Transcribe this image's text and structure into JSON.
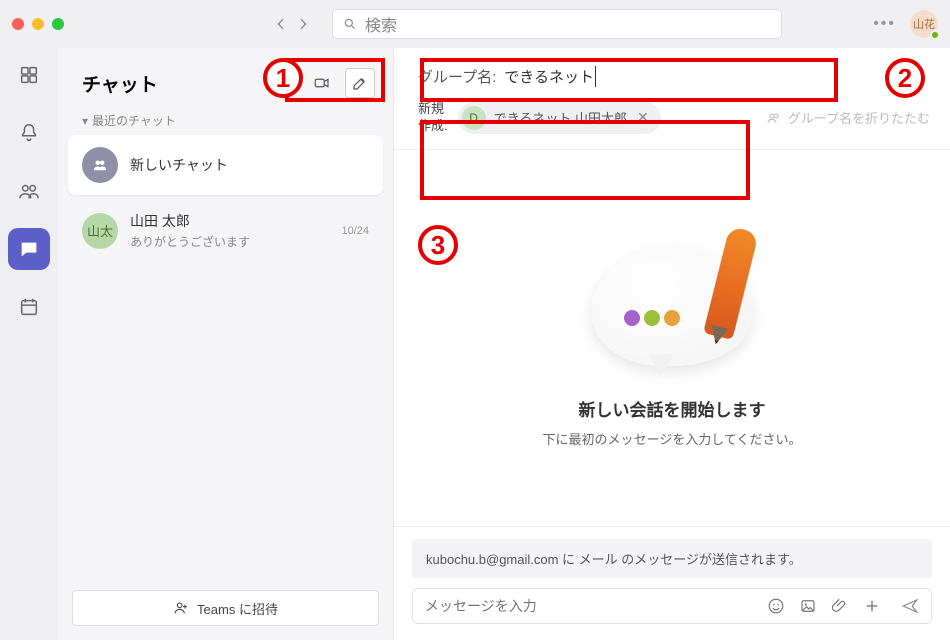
{
  "titlebar": {
    "search_placeholder": "検索",
    "avatar_initials": "山花"
  },
  "sidebar": {
    "title": "チャット",
    "recent_label": "最近のチャット",
    "items": [
      {
        "avatar": "",
        "name": "新しいチャット",
        "preview": "",
        "time": ""
      },
      {
        "avatar": "山太",
        "name": "山田 太郎",
        "preview": "ありがとうございます",
        "time": "10/24"
      }
    ],
    "invite_label": "Teams に招待"
  },
  "main": {
    "group_label": "グループ名:",
    "group_value": "できるネット",
    "recipient_label_line1": "新規",
    "recipient_label_line2": "作成:",
    "chip_initial": "D",
    "chip_name": "できるネット 山田太郎",
    "fold_label": "グループ名を折りたたむ",
    "empty_title": "新しい会話を開始します",
    "empty_sub": "下に最初のメッセージを入力してください。",
    "notice": "kubochu.b@gmail.com に メール のメッセージが送信されます。",
    "compose_placeholder": "メッセージを入力"
  },
  "annotations": {
    "n1": "1",
    "n2": "2",
    "n3": "3"
  }
}
